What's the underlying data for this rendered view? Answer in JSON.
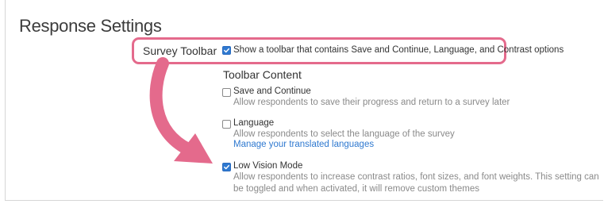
{
  "section": {
    "title": "Response Settings"
  },
  "survey_toolbar": {
    "label": "Survey Toolbar",
    "checked": true,
    "option_text": "Show a toolbar that contains Save and Continue, Language, and Contrast options"
  },
  "toolbar_content": {
    "heading": "Toolbar Content",
    "options": [
      {
        "title": "Save and Continue",
        "description": "Allow respondents to save their progress and return to a survey later",
        "checked": false
      },
      {
        "title": "Language",
        "description": "Allow respondents to select the language of the survey",
        "link": "Manage your translated languages",
        "checked": false
      },
      {
        "title": "Low Vision Mode",
        "description": "Allow respondents to increase contrast ratios, font sizes, and font weights. This setting can be toggled and when activated, it will remove custom themes",
        "checked": true
      }
    ]
  },
  "colors": {
    "annotation_pink": "#e46a8c",
    "checkbox_blue": "#2f79d0",
    "link_blue": "#2f79d0",
    "text_dark": "#333333",
    "text_muted": "#8a8a8a"
  },
  "icons": {
    "arrow": "curved-arrow-annotation",
    "check": "checkmark"
  }
}
